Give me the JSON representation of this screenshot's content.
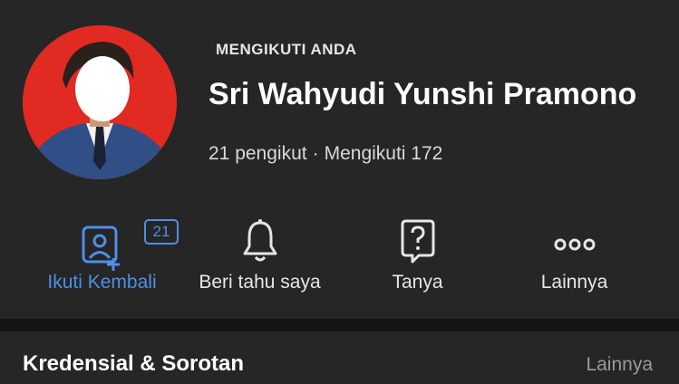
{
  "profile": {
    "follows_you": "MENGIKUTI ANDA",
    "name": "Sri Wahyudi Yunshi Pramono",
    "followers": "21 pengikut",
    "separator": "·",
    "following": "Mengikuti 172"
  },
  "actions": [
    {
      "label": "Ikuti Kembali",
      "icon": "follow-back-icon",
      "badge": "21"
    },
    {
      "label": "Beri tahu saya",
      "icon": "bell-icon"
    },
    {
      "label": "Tanya",
      "icon": "question-icon"
    },
    {
      "label": "Lainnya",
      "icon": "more-dots-icon"
    }
  ],
  "section": {
    "title": "Kredensial & Sorotan",
    "more": "Lainnya"
  },
  "colors": {
    "background": "#262626",
    "accent": "#4f8fe6",
    "avatar_bg": "#e02a22",
    "divider": "#141414"
  }
}
